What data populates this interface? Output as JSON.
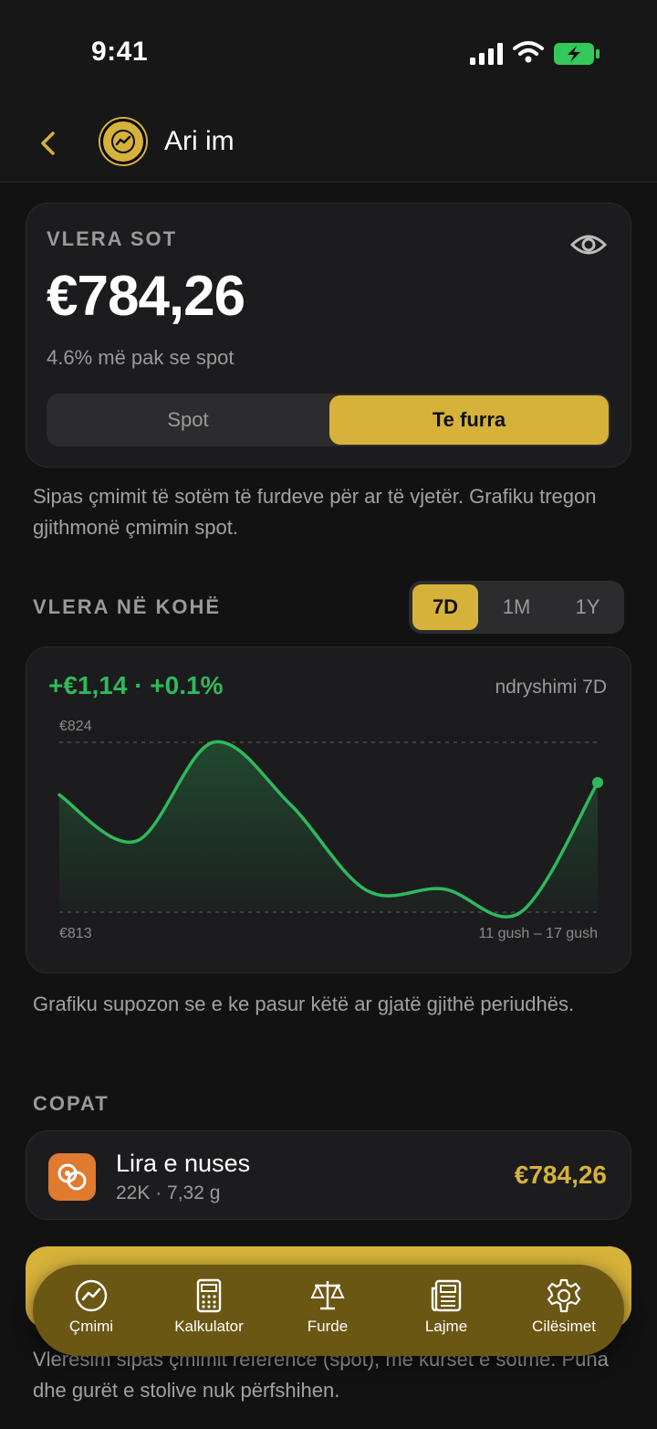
{
  "status": {
    "time": "9:41"
  },
  "nav": {
    "title": "Ari im"
  },
  "value_card": {
    "label": "VLERA SOT",
    "value": "€784,26",
    "subtitle": "4.6% më pak se spot",
    "segments": [
      "Spot",
      "Te furra"
    ],
    "selected_segment": "Te furra"
  },
  "value_note": "Sipas çmimit të sotëm të furdeve për ar të vjetër. Grafiku tregon gjithmonë çmimin spot.",
  "over_time": {
    "title": "VLERA NË KOHË",
    "ranges": [
      "7D",
      "1M",
      "1Y"
    ],
    "selected_range": "7D"
  },
  "chart_data": {
    "type": "line",
    "title": "",
    "change_text": "+€1,14 · +0.1%",
    "change_label": "ndryshimi 7D",
    "y_max_label": "€824",
    "y_min_label": "€813",
    "x_range_label": "11 gush – 17 gush",
    "ylim": [
      813,
      824
    ],
    "series": [
      {
        "values": [
          820.6,
          817.6,
          824.0,
          820.0,
          814.4,
          814.5,
          813.0,
          821.4
        ]
      }
    ],
    "color": "#2fb95c"
  },
  "chart_note": "Grafiku supozon se e ke pasur këtë ar gjatë gjithë periudhës.",
  "copat": {
    "title": "COPAT",
    "items": [
      {
        "name": "Lira e nuses",
        "detail": "22K · 7,32 g",
        "value": "€784,26"
      }
    ]
  },
  "tabs": [
    {
      "label": "Çmimi",
      "icon": "trend-icon"
    },
    {
      "label": "Kalkulator",
      "icon": "calculator-icon"
    },
    {
      "label": "Furde",
      "icon": "scale-icon"
    },
    {
      "label": "Lajme",
      "icon": "news-icon"
    },
    {
      "label": "Cilësimet",
      "icon": "gear-icon"
    }
  ],
  "bottom_note": "Vlerësim sipas çmimit referencë (spot), me kurset e sotme. Puna dhe gurët e stolive nuk përfshihen."
}
